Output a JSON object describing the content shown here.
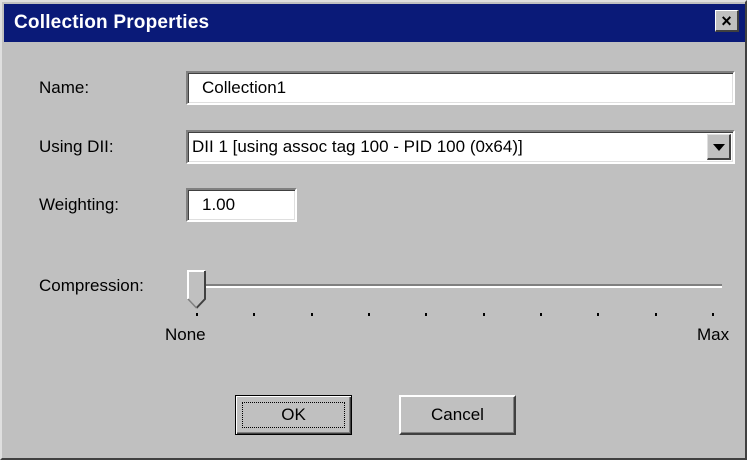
{
  "window": {
    "title": "Collection Properties",
    "close_glyph": "×"
  },
  "colors": {
    "titlebar": "#0a1a78",
    "face": "#c0c0c0"
  },
  "form": {
    "name": {
      "label": "Name:",
      "value": "Collection1"
    },
    "using_dii": {
      "label": "Using DII:",
      "value": "DII 1 [using assoc tag 100 - PID 100 (0x64)]"
    },
    "weighting": {
      "label": "Weighting:",
      "value": "1.00"
    },
    "compression": {
      "label": "Compression:",
      "min_label": "None",
      "max_label": "Max",
      "level": 0,
      "tick_count": 10
    }
  },
  "buttons": {
    "ok_label": "OK",
    "cancel_label": "Cancel"
  }
}
